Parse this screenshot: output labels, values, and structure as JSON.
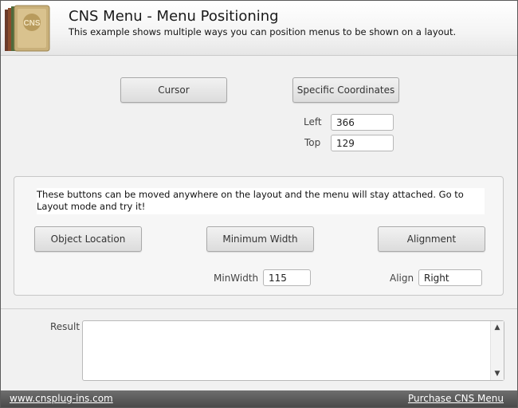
{
  "header": {
    "title": "CNS Menu - Menu Positioning",
    "subtitle": "This example shows multiple ways you can position menus to be shown on a layout.",
    "logo_text": "CNS"
  },
  "top": {
    "cursor_label": "Cursor",
    "specific_label": "Specific Coordinates",
    "left_label": "Left",
    "left_value": "366",
    "top_label": "Top",
    "top_value": "129"
  },
  "panel": {
    "note": "These buttons can be moved anywhere on the layout and the menu will stay attached. Go to Layout mode and try it!",
    "object_location_label": "Object Location",
    "minimum_width_label": "Minimum Width",
    "alignment_label": "Alignment",
    "minwidth_label": "MinWidth",
    "minwidth_value": "115",
    "align_label": "Align",
    "align_value": "Right"
  },
  "result": {
    "label": "Result",
    "value": ""
  },
  "footer": {
    "left_link": "www.cnsplug-ins.com",
    "right_link": "Purchase CNS Menu"
  },
  "icons": {
    "scroll_up": "▲",
    "scroll_down": "▼"
  }
}
